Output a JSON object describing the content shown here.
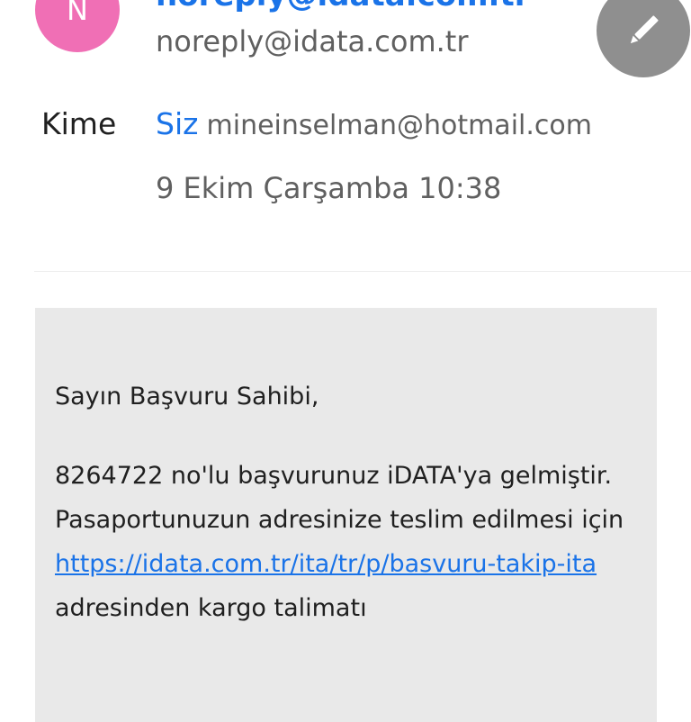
{
  "header": {
    "avatar_letter": "N",
    "sender_name": "noreply@idata.com.tr",
    "sender_email": "noreply@idata.com.tr",
    "avatar_color": "#f06fb5",
    "compose_icon": "pencil-icon"
  },
  "recipient": {
    "label": "Kime",
    "name": "Siz",
    "email": "mineinselman@hotmail.com"
  },
  "date": "9 Ekim Çarşamba 10:38",
  "message": {
    "greeting": "Sayın Başvuru Sahibi,",
    "line1": "8264722 no'lu başvurunuz iDATA'ya gelmiştir. Pasaportunuzun adresinize teslim edilmesi için",
    "link": "https://idata.com.tr/ita/tr/p/basvuru-takip-ita",
    "line2": "adresinden kargo talimatı"
  },
  "colors": {
    "link": "#1a73e8",
    "card_background": "#e9e9e9",
    "fab": "#8f8f8f"
  }
}
